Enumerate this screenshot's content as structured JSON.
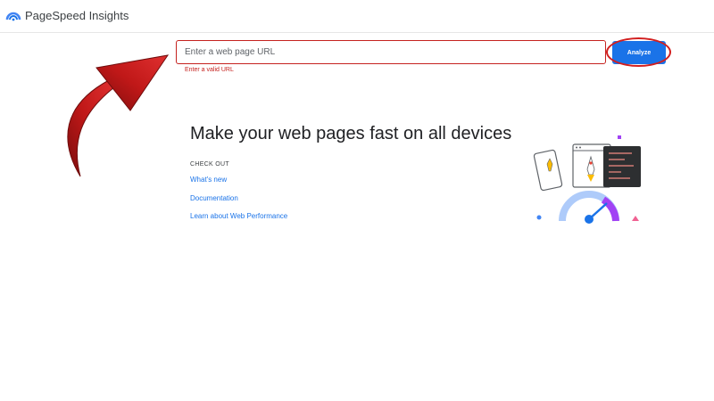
{
  "header": {
    "app_title": "PageSpeed Insights",
    "logo_icon": "pagespeed-gauge-icon"
  },
  "search": {
    "placeholder": "Enter a web page URL",
    "value": "",
    "error": "Enter a valid URL",
    "analyze_label": "Analyze"
  },
  "main": {
    "headline": "Make your web pages fast on all devices",
    "check_out_heading": "CHECK OUT",
    "links": [
      {
        "label": "What's new"
      },
      {
        "label": "Documentation"
      },
      {
        "label": "Learn about Web Performance"
      }
    ]
  },
  "colors": {
    "accent_blue": "#1a73e8",
    "error_red": "#c5221f",
    "annotation_red": "#d21f1f"
  }
}
